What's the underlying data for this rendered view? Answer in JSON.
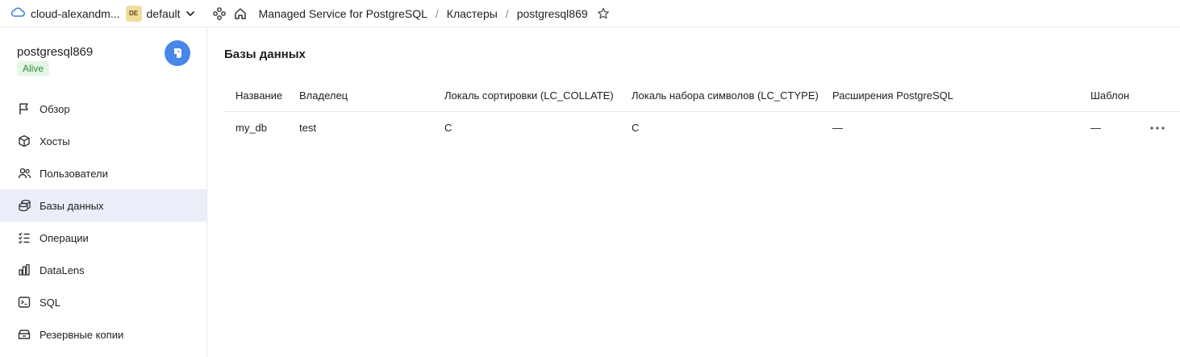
{
  "topbar": {
    "cloud_name": "cloud-alexandm...",
    "folder_badge": "DE",
    "folder_name": "default",
    "breadcrumbs": [
      "Managed Service for PostgreSQL",
      "Кластеры",
      "postgresql869"
    ],
    "separator": "/"
  },
  "sidebar": {
    "cluster_name": "postgresql869",
    "status": "Alive",
    "items": [
      {
        "label": "Обзор",
        "icon": "flag-icon"
      },
      {
        "label": "Хосты",
        "icon": "cube-icon"
      },
      {
        "label": "Пользователи",
        "icon": "users-icon"
      },
      {
        "label": "Базы данных",
        "icon": "database-icon",
        "active": true
      },
      {
        "label": "Операции",
        "icon": "list-check-icon"
      },
      {
        "label": "DataLens",
        "icon": "chart-icon"
      },
      {
        "label": "SQL",
        "icon": "terminal-icon"
      },
      {
        "label": "Резервные копии",
        "icon": "archive-icon"
      }
    ]
  },
  "main": {
    "title": "Базы данных",
    "columns": [
      "Название",
      "Владелец",
      "Локаль сортировки (LC_COLLATE)",
      "Локаль набора символов (LC_CTYPE)",
      "Расширения PostgreSQL",
      "Шаблон"
    ],
    "rows": [
      [
        "my_db",
        "test",
        "C",
        "C",
        "—",
        "—"
      ]
    ]
  },
  "colors": {
    "accent": "#4a86e8",
    "active_nav_bg": "#e9eef8",
    "status_bg": "#e5f6e6",
    "status_text": "#2e8b3d",
    "folder_badge_bg": "#f0dd9e"
  }
}
